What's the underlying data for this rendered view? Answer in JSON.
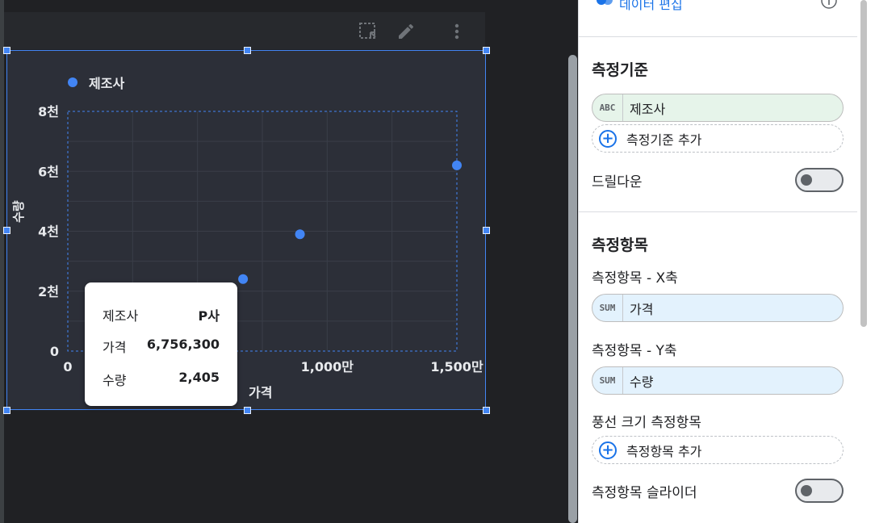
{
  "panel": {
    "top_link": "데이터 편집",
    "dimension_section": {
      "title": "측정기준",
      "dimension_chip": {
        "type": "ABC",
        "label": "제조사"
      },
      "add_dimension": "측정기준 추가",
      "drilldown_label": "드릴다운",
      "drilldown_on": false
    },
    "metric_section": {
      "title": "측정항목",
      "x_label": "측정항목 - X축",
      "x_chip": {
        "type": "SUM",
        "label": "가격"
      },
      "y_label": "측정항목 - Y축",
      "y_chip": {
        "type": "SUM",
        "label": "수량"
      },
      "bubble_label": "풍선 크기 측정항목",
      "add_metric": "측정항목 추가",
      "slider_label": "측정항목 슬라이더",
      "slider_on": false
    }
  },
  "chart_data": {
    "type": "scatter",
    "legend": [
      "제조사"
    ],
    "xlabel": "가격",
    "ylabel": "수량",
    "xlim": [
      0,
      15000000
    ],
    "ylim": [
      0,
      8000
    ],
    "x_ticks": [
      {
        "value": 0,
        "label": "0"
      },
      {
        "value": 10000000,
        "label": "1,000만"
      },
      {
        "value": 15000000,
        "label": "1,500만"
      }
    ],
    "y_ticks": [
      {
        "value": 0,
        "label": "0"
      },
      {
        "value": 2000,
        "label": "2천"
      },
      {
        "value": 4000,
        "label": "4천"
      },
      {
        "value": 6000,
        "label": "6천"
      },
      {
        "value": 8000,
        "label": "8천"
      }
    ],
    "series": [
      {
        "name": "제조사",
        "color": "#4285f4",
        "points": [
          {
            "x": 6756300,
            "y": 2405
          },
          {
            "x": 8950000,
            "y": 3900
          },
          {
            "x": 15000000,
            "y": 6200
          }
        ]
      }
    ],
    "grid": true
  },
  "tooltip": {
    "rows": [
      {
        "label": "제조사",
        "value": "P사"
      },
      {
        "label": "가격",
        "value": "6,756,300"
      },
      {
        "label": "수량",
        "value": "2,405"
      }
    ]
  }
}
